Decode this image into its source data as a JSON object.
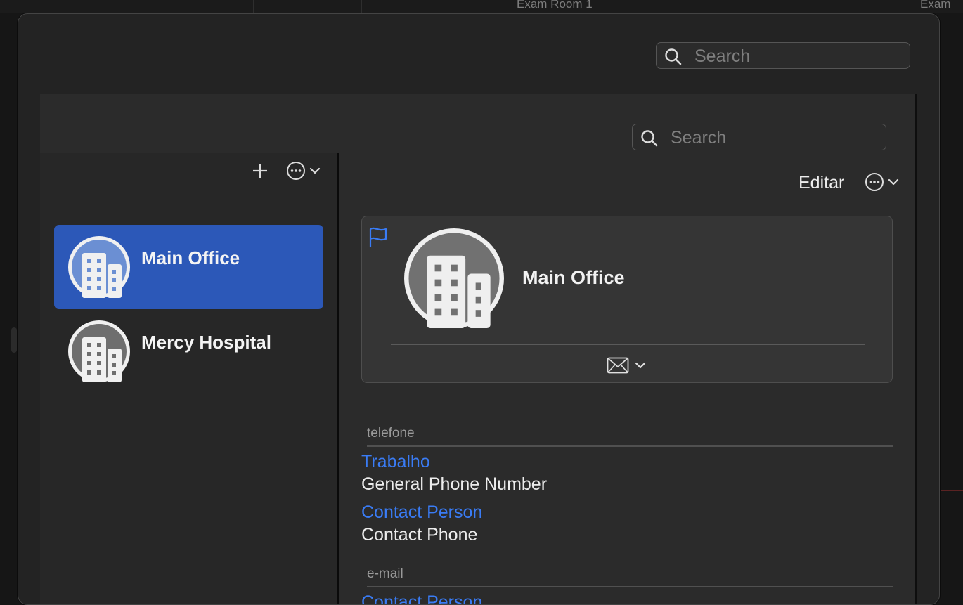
{
  "background": {
    "tab_labels": [
      "Exam Room 1",
      "Exam "
    ]
  },
  "search": {
    "placeholder": "Search"
  },
  "inner_search": {
    "placeholder": "Search"
  },
  "list": [
    {
      "name": "Main Office",
      "selected": true
    },
    {
      "name": "Mercy Hospital",
      "selected": false
    }
  ],
  "detail": {
    "edit_label": "Editar",
    "title": "Main Office",
    "sections": {
      "phone_label": "telefone",
      "phone_rows": [
        {
          "label": "Trabalho",
          "value": "General Phone Number"
        },
        {
          "label": "Contact Person",
          "value": "Contact Phone"
        }
      ],
      "email_label": "e-mail",
      "email_rows": [
        {
          "label": "Contact Person"
        }
      ]
    }
  },
  "colors": {
    "accent": "#3a7cf5",
    "selection": "#2c58b8",
    "window_bg": "#232323"
  }
}
